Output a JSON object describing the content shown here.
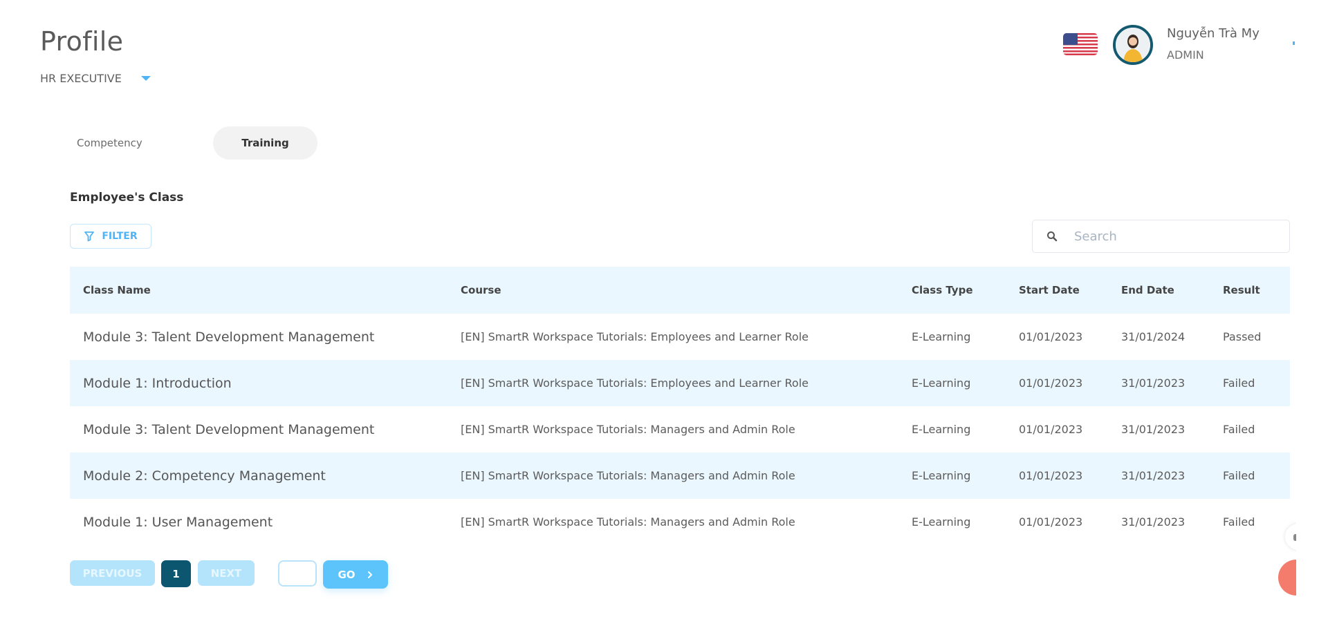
{
  "header": {
    "title": "Profile",
    "role_selector": "HR EXECUTIVE",
    "language_icon": "us-flag-icon",
    "user": {
      "name": "Nguyễn Trà My",
      "role": "ADMIN"
    }
  },
  "tabs": [
    {
      "label": "Competency",
      "active": false
    },
    {
      "label": "Training",
      "active": true
    }
  ],
  "section": {
    "title": "Employee's Class",
    "filter_label": "FILTER",
    "search_placeholder": "Search",
    "search_value": ""
  },
  "table": {
    "columns": [
      "Class Name",
      "Course",
      "Class Type",
      "Start Date",
      "End Date",
      "Result"
    ],
    "rows": [
      [
        "Module 3: Talent Development Management",
        "[EN] SmartR Workspace Tutorials: Employees and Learner Role",
        "E-Learning",
        "01/01/2023",
        "31/01/2024",
        "Passed"
      ],
      [
        "Module 1: Introduction",
        "[EN] SmartR Workspace Tutorials: Employees and Learner Role",
        "E-Learning",
        "01/01/2023",
        "31/01/2023",
        "Failed"
      ],
      [
        "Module 3: Talent Development Management",
        "[EN] SmartR Workspace Tutorials: Managers and Admin Role",
        "E-Learning",
        "01/01/2023",
        "31/01/2023",
        "Failed"
      ],
      [
        "Module 2: Competency Management",
        "[EN] SmartR Workspace Tutorials: Managers and Admin Role",
        "E-Learning",
        "01/01/2023",
        "31/01/2023",
        "Failed"
      ],
      [
        "Module 1: User Management",
        "[EN] SmartR Workspace Tutorials: Managers and Admin Role",
        "E-Learning",
        "01/01/2023",
        "31/01/2023",
        "Failed"
      ]
    ]
  },
  "pagination": {
    "previous_label": "PREVIOUS",
    "current_page": "1",
    "next_label": "NEXT",
    "goto_value": "",
    "go_label": "GO",
    "go_icon": "chevron-right-icon"
  },
  "colors": {
    "accent": "#4fb3f6",
    "row_highlight": "#eaf7fe",
    "active_page": "#0d566f",
    "go_button": "#5cc4fb",
    "chat_widget": "#f47c6c"
  }
}
